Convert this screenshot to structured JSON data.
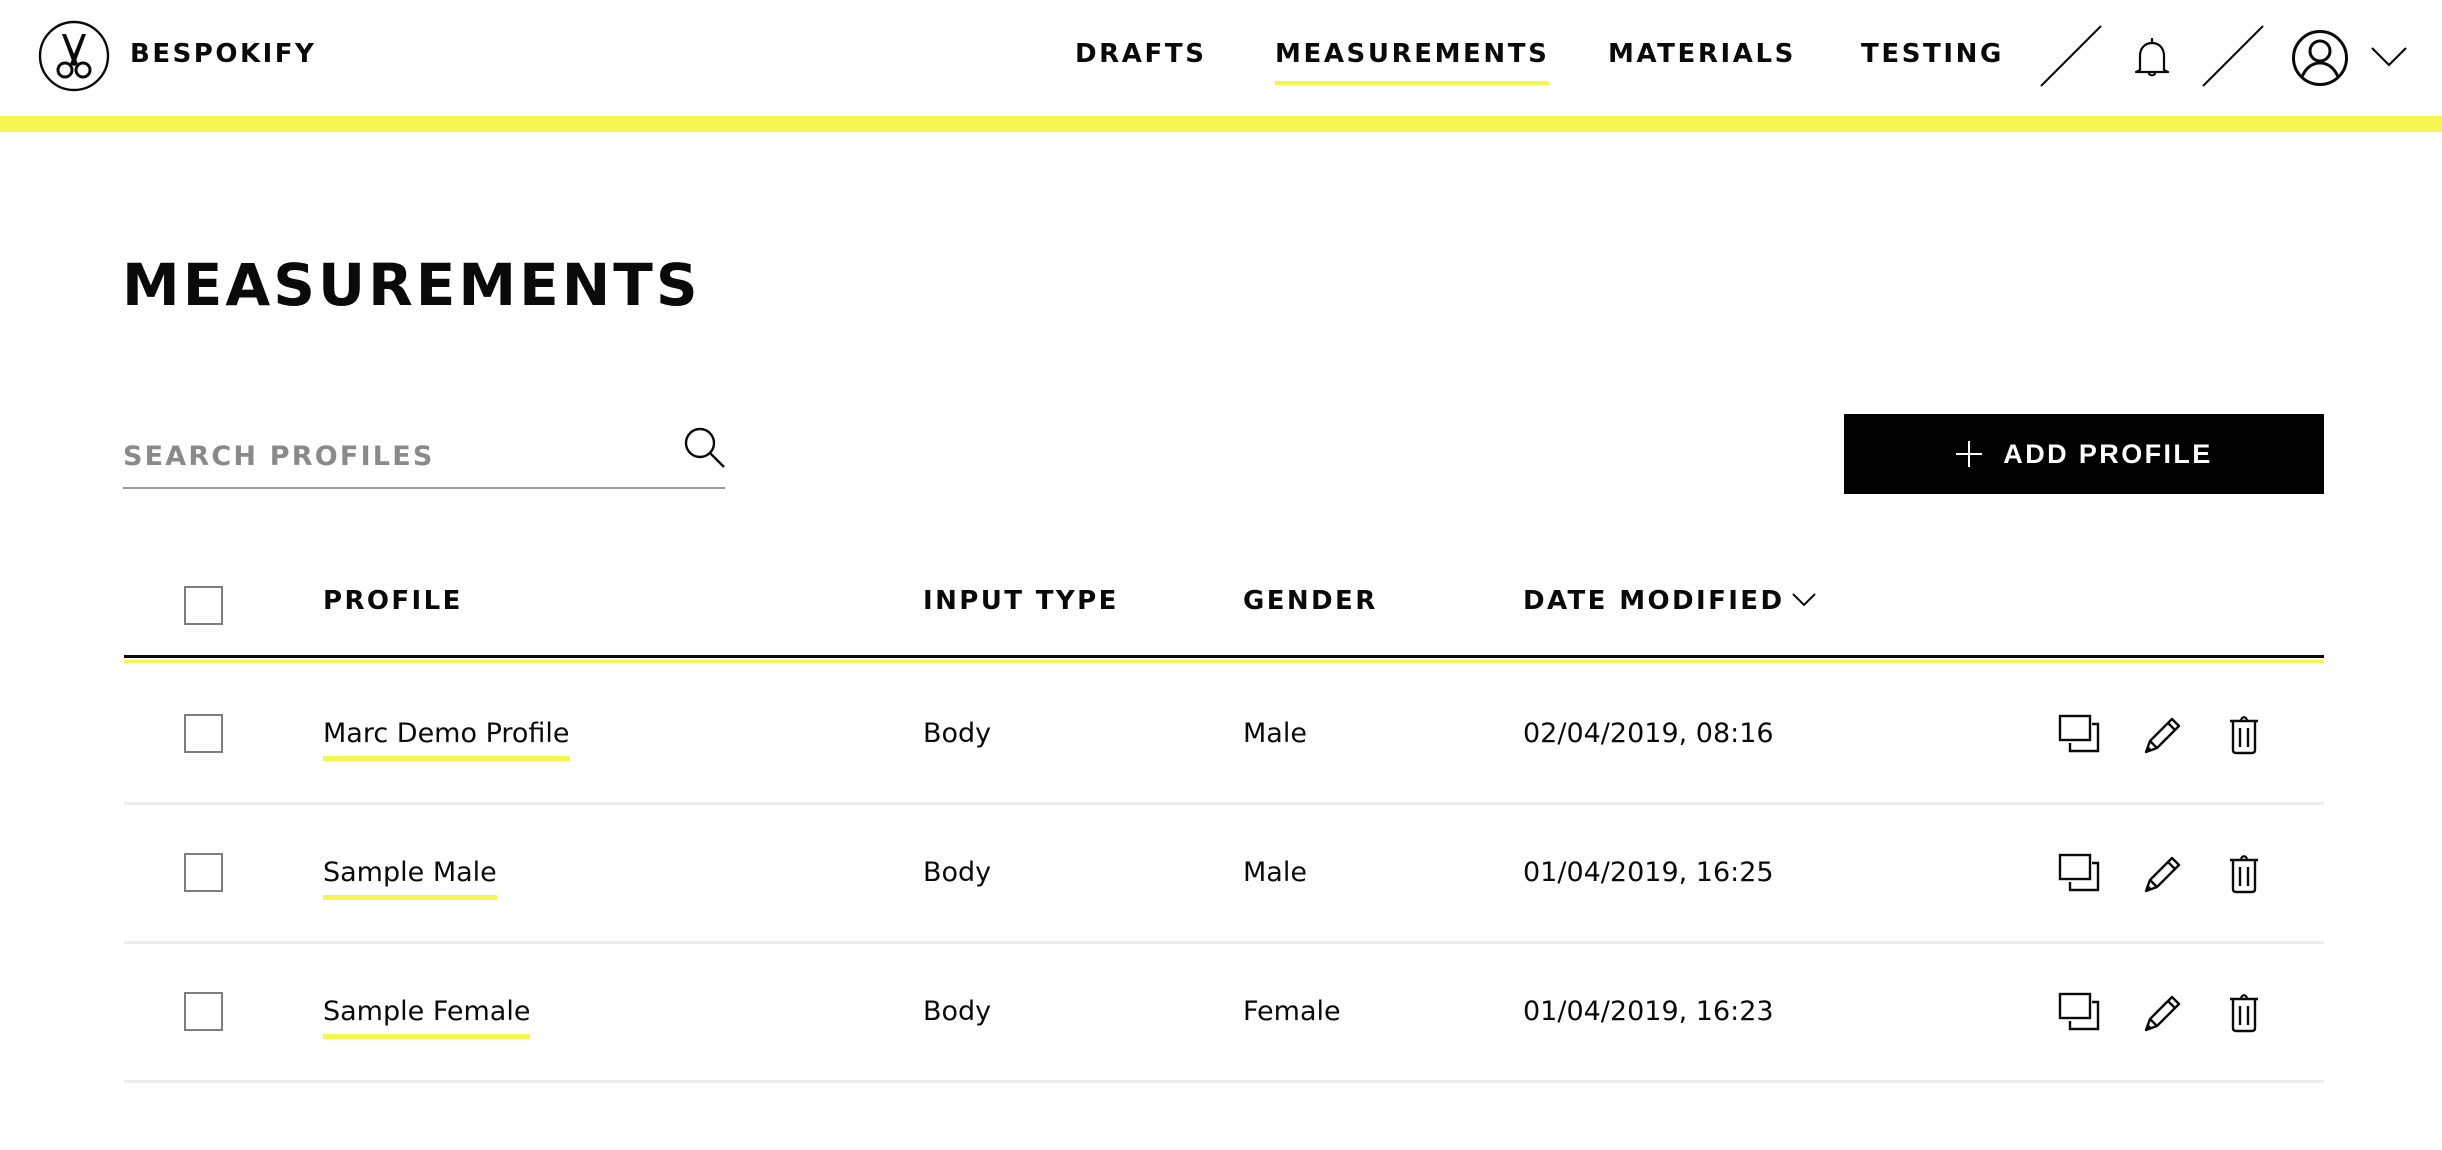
{
  "header": {
    "brand": "BESPOKIFY",
    "logo_icon": "scissors-icon",
    "nav": [
      {
        "label": "DRAFTS",
        "active": false
      },
      {
        "label": "MEASUREMENTS",
        "active": true
      },
      {
        "label": "MATERIALS",
        "active": false
      },
      {
        "label": "TESTING",
        "active": false
      }
    ],
    "icons": [
      "bell-icon",
      "user-avatar-icon",
      "chevron-down-icon"
    ]
  },
  "colors": {
    "accent": "#f7f552",
    "text": "#0a0a0a",
    "button_bg": "#000000",
    "button_text": "#ffffff",
    "placeholder": "#8a8a8a",
    "divider": "#ececec"
  },
  "page": {
    "title": "MEASUREMENTS",
    "search": {
      "placeholder": "SEARCH PROFILES",
      "value": ""
    },
    "add_button": {
      "label": "ADD PROFILE",
      "icon": "plus-icon"
    }
  },
  "table": {
    "columns": [
      "PROFILE",
      "INPUT TYPE",
      "GENDER",
      "DATE MODIFIED"
    ],
    "sort": {
      "column": "DATE MODIFIED",
      "direction": "desc"
    },
    "rows": [
      {
        "profile": "Marc Demo Profile",
        "input_type": "Body",
        "gender": "Male",
        "date_modified": "02/04/2019, 08:16",
        "checked": false
      },
      {
        "profile": "Sample Male",
        "input_type": "Body",
        "gender": "Male",
        "date_modified": "01/04/2019, 16:25",
        "checked": false
      },
      {
        "profile": "Sample Female",
        "input_type": "Body",
        "gender": "Female",
        "date_modified": "01/04/2019, 16:23",
        "checked": false
      }
    ],
    "row_actions": [
      "duplicate-icon",
      "edit-icon",
      "delete-icon"
    ]
  }
}
